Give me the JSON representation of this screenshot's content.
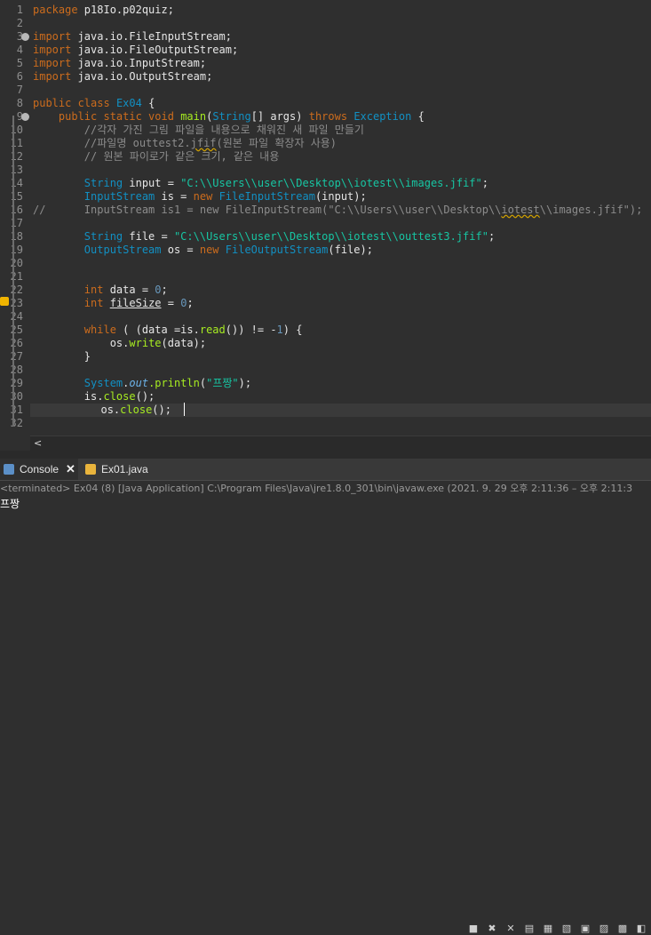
{
  "editor": {
    "line_numbers": [
      "1",
      "2",
      "3",
      "4",
      "5",
      "6",
      "7",
      "8",
      "9",
      "10",
      "11",
      "12",
      "13",
      "14",
      "15",
      "16",
      "17",
      "18",
      "19",
      "20",
      "21",
      "22",
      "23",
      "24",
      "25",
      "26",
      "27",
      "28",
      "29",
      "30",
      "31",
      "32"
    ],
    "code": {
      "l1_kw": "package",
      "l1_rest": " p18Io.p02quiz;",
      "l3_kw": "import",
      "l3_rest": " java.io.FileInputStream;",
      "l4_kw": "import",
      "l4_rest": " java.io.FileOutputStream;",
      "l5_kw": "import",
      "l5_rest": " java.io.InputStream;",
      "l6_kw": "import",
      "l6_rest": " java.io.OutputStream;",
      "l8_kw": "public class",
      "l8_ty": "Ex04",
      "l8_rest": " {",
      "l9_kw1": "public static void",
      "l9_fn": "main",
      "l9_p1": "(",
      "l9_ty1": "String",
      "l9_p2": "[] args) ",
      "l9_kw2": "throws",
      "l9_ty2": "Exception",
      "l9_p3": " {",
      "l10": "//각자 가진 그림 파일을 내용으로 채워진 새 파일 만들기",
      "l11_a": "//파일명 outtest2.",
      "l11_b": "jfif",
      "l11_c": "(원본 파일 확장자 사용)",
      "l12": "// 원본 파이로가 같은 크기, 같은 내용",
      "l14_ty": "String",
      "l14_var": " input = ",
      "l14_str": "\"C:\\\\Users\\\\user\\\\Desktop\\\\iotest\\\\images.jfif\"",
      "l14_end": ";",
      "l15_ty": "InputStream",
      "l15_var": " is = ",
      "l15_kw": "new",
      "l15_ty2": "FileInputStream",
      "l15_end": "(input);",
      "l16_a": "//      InputStream is1 = new FileInputStream(\"C:\\\\Users\\\\user\\\\Desktop\\\\",
      "l16_b": "iotest",
      "l16_c": "\\\\images.jfif\");",
      "l18_ty": "String",
      "l18_var": " file = ",
      "l18_str": "\"C:\\\\Users\\\\user\\\\Desktop\\\\iotest\\\\outtest3.jfif\"",
      "l18_end": ";",
      "l19_ty": "OutputStream",
      "l19_var": " os = ",
      "l19_kw": "new",
      "l19_ty2": "FileOutputStream",
      "l19_end": "(file);",
      "l22_kw": "int",
      "l22_var": " data = ",
      "l22_num": "0",
      "l22_end": ";",
      "l23_kw": "int",
      "l23_var": "fileSize",
      "l23_mid": " = ",
      "l23_num": "0",
      "l23_end": ";",
      "l25_kw": "while",
      "l25_a": " ( (data =is.",
      "l25_fn": "read",
      "l25_b": "()) != -",
      "l25_num": "1",
      "l25_c": ") {",
      "l26_a": "os.",
      "l26_fn": "write",
      "l26_b": "(data);",
      "l27": "}",
      "l29_ty": "System",
      "l29_dot": ".",
      "l29_fld": "out",
      "l29_fn": ".println",
      "l29_p": "(",
      "l29_str": "\"프짱\"",
      "l29_end": ");",
      "l30_a": "is.",
      "l30_fn": "close",
      "l30_b": "();",
      "l31_a": "os.",
      "l31_fn": "close",
      "l31_b": "();"
    }
  },
  "hscroll": {
    "arrow": "<"
  },
  "tabs": {
    "console_label": "Console",
    "console_close": "✕",
    "file_label": "Ex01.java"
  },
  "status": {
    "text": "<terminated> Ex04 (8) [Java Application] C:\\Program Files\\Java\\jre1.8.0_301\\bin\\javaw.exe  (2021. 9. 29 오후 2:11:36 – 오후 2:11:3"
  },
  "console": {
    "output": "프짱"
  },
  "colors": {
    "background": "#2f2f2f",
    "keyword": "#cc6c1d",
    "type": "#1290c3",
    "string": "#17c6a3",
    "comment": "#8c8c8c",
    "method": "#a7ec21"
  }
}
